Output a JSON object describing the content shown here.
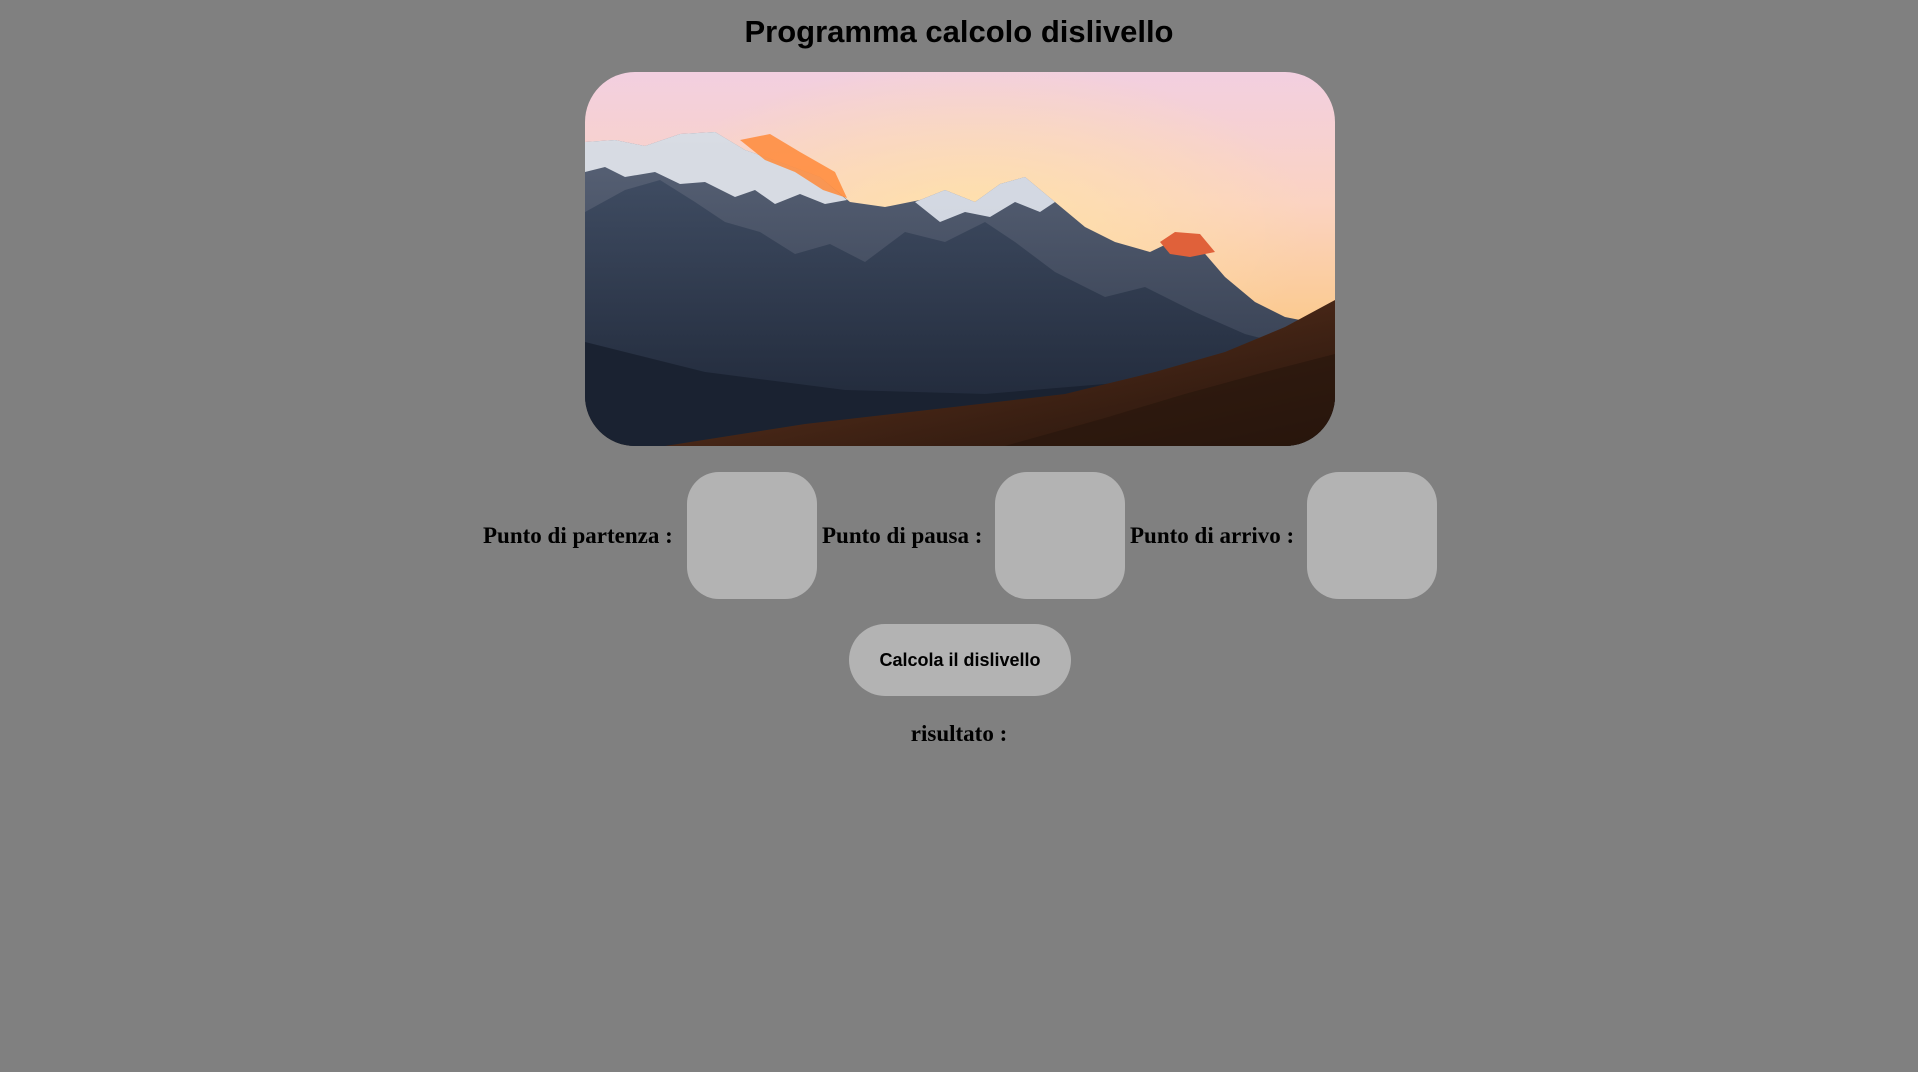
{
  "page": {
    "title": "Programma calcolo dislivello",
    "background_color": "#808080"
  },
  "hero_image": {
    "subject": "mountain-sunset-photo"
  },
  "fields": [
    {
      "label": "Punto di partenza :",
      "value": ""
    },
    {
      "label": "Punto di pausa :",
      "value": ""
    },
    {
      "label": "Punto di arrivo :",
      "value": ""
    }
  ],
  "calculate_button": {
    "label": "Calcola il dislivello"
  },
  "result": {
    "label": "risultato :"
  },
  "colors": {
    "input_background": "#b3b3b3",
    "button_background": "#b3b3b3"
  }
}
